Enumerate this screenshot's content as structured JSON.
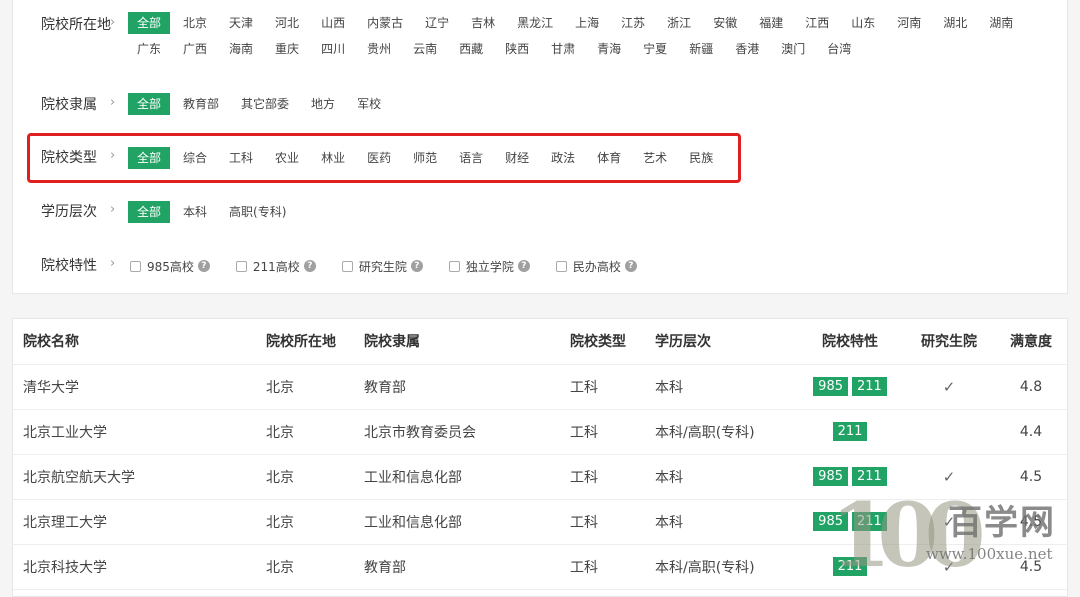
{
  "filters": {
    "region": {
      "label": "院校所在地",
      "options": [
        "全部",
        "北京",
        "天津",
        "河北",
        "山西",
        "内蒙古",
        "辽宁",
        "吉林",
        "黑龙江",
        "上海",
        "江苏",
        "浙江",
        "安徽",
        "福建",
        "江西",
        "山东",
        "河南",
        "湖北",
        "湖南",
        "广东",
        "广西",
        "海南",
        "重庆",
        "四川",
        "贵州",
        "云南",
        "西藏",
        "陕西",
        "甘肃",
        "青海",
        "宁夏",
        "新疆",
        "香港",
        "澳门",
        "台湾"
      ]
    },
    "affiliation": {
      "label": "院校隶属",
      "options": [
        "全部",
        "教育部",
        "其它部委",
        "地方",
        "军校"
      ]
    },
    "type": {
      "label": "院校类型",
      "options": [
        "全部",
        "综合",
        "工科",
        "农业",
        "林业",
        "医药",
        "师范",
        "语言",
        "财经",
        "政法",
        "体育",
        "艺术",
        "民族"
      ]
    },
    "level": {
      "label": "学历层次",
      "options": [
        "全部",
        "本科",
        "高职(专科)"
      ]
    },
    "features": {
      "label": "院校特性",
      "options": [
        "985高校",
        "211高校",
        "研究生院",
        "独立学院",
        "民办高校"
      ]
    },
    "chevron": "›",
    "help_glyph": "?",
    "active_color": "#21a366",
    "highlight_color": "#e02020"
  },
  "table": {
    "headers": [
      "院校名称",
      "院校所在地",
      "院校隶属",
      "院校类型",
      "学历层次",
      "院校特性",
      "研究生院",
      "满意度"
    ],
    "rows": [
      {
        "name": "清华大学",
        "location": "北京",
        "affiliation": "教育部",
        "type": "工科",
        "level": "本科",
        "tags": [
          "985",
          "211"
        ],
        "grad": "✓",
        "sat": "4.8"
      },
      {
        "name": "北京工业大学",
        "location": "北京",
        "affiliation": "北京市教育委员会",
        "type": "工科",
        "level": "本科/高职(专科)",
        "tags": [
          "211"
        ],
        "grad": "",
        "sat": "4.4"
      },
      {
        "name": "北京航空航天大学",
        "location": "北京",
        "affiliation": "工业和信息化部",
        "type": "工科",
        "level": "本科",
        "tags": [
          "985",
          "211"
        ],
        "grad": "✓",
        "sat": "4.5"
      },
      {
        "name": "北京理工大学",
        "location": "北京",
        "affiliation": "工业和信息化部",
        "type": "工科",
        "level": "本科",
        "tags": [
          "985",
          "211"
        ],
        "grad": "✓",
        "sat": "4.5"
      },
      {
        "name": "北京科技大学",
        "location": "北京",
        "affiliation": "教育部",
        "type": "工科",
        "level": "本科/高职(专科)",
        "tags": [
          "211"
        ],
        "grad": "✓",
        "sat": "4.5"
      }
    ]
  },
  "watermark": {
    "logo": "100",
    "brand": "百学网",
    "url": "www.100xue.net"
  }
}
